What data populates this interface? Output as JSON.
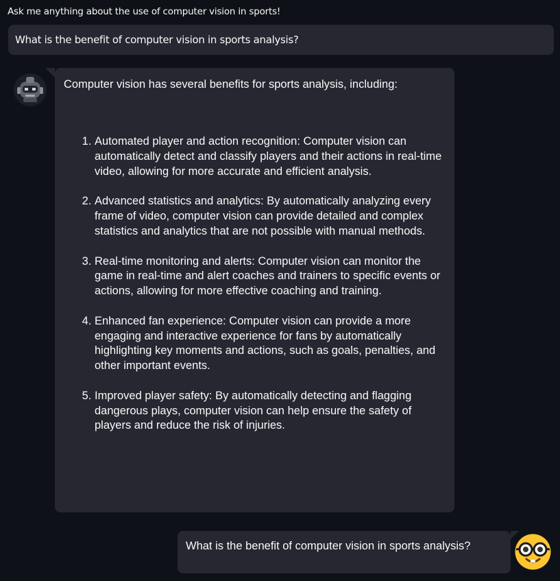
{
  "header": {
    "prompt_label": "Ask me anything about the use of computer vision in sports!"
  },
  "input": {
    "value": "What is the benefit of computer vision in sports analysis?"
  },
  "chat": {
    "bot_message": {
      "avatar_icon": "robot-icon",
      "intro": "Computer vision has several benefits for sports analysis, including:",
      "items": [
        "Automated player and action recognition: Computer vision can automatically detect and classify players and their actions in real-time video, allowing for more accurate and efficient analysis.",
        "Advanced statistics and analytics: By automatically analyzing every frame of video, computer vision can provide detailed and complex statistics and analytics that are not possible with manual methods.",
        "Real-time monitoring and alerts: Computer vision can monitor the game in real-time and alert coaches and trainers to specific events or actions, allowing for more effective coaching and training.",
        "Enhanced fan experience: Computer vision can provide a more engaging and interactive experience for fans by automatically highlighting key moments and actions, such as goals, penalties, and other important events.",
        "Improved player safety: By automatically detecting and flagging dangerous plays, computer vision can help ensure the safety of players and reduce the risk of injuries."
      ]
    },
    "user_message": {
      "avatar_icon": "nerd-face-icon",
      "text": "What is the benefit of computer vision in sports analysis?"
    }
  },
  "colors": {
    "background": "#0e1117",
    "bubble": "#262730",
    "text": "#fafafa",
    "user_avatar": "#fbc530"
  }
}
